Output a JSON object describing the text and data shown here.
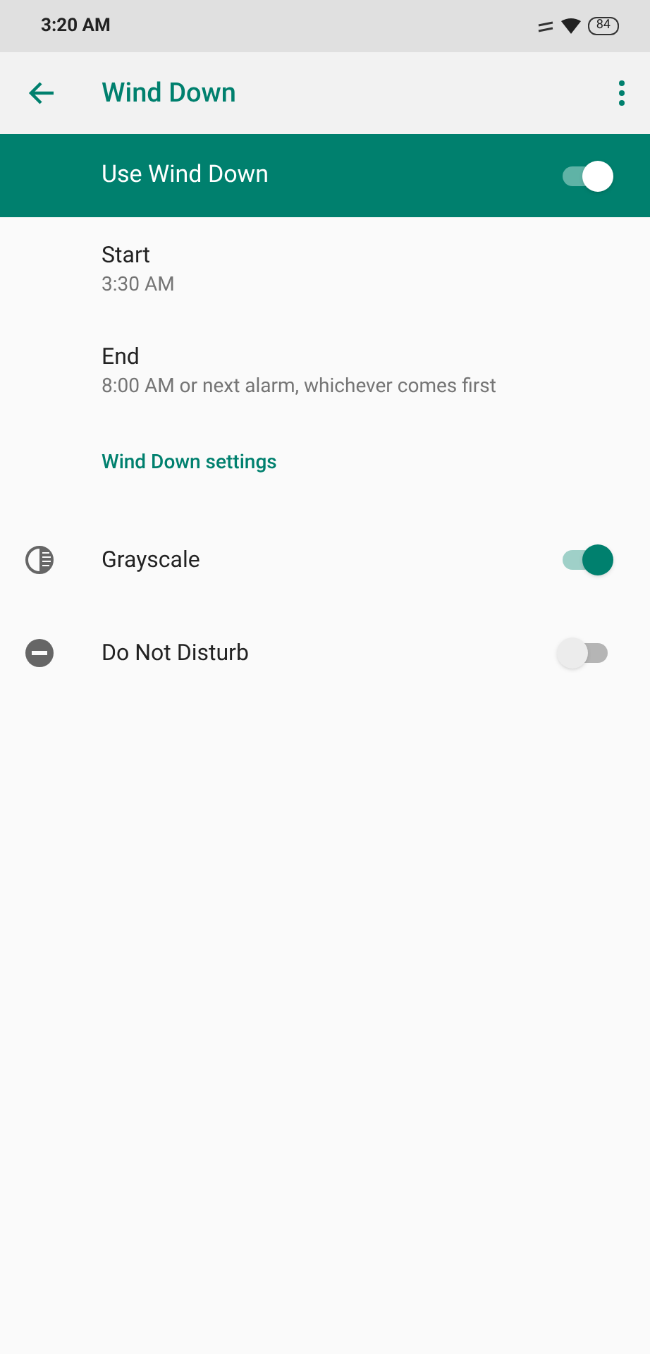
{
  "status_bar": {
    "time": "3:20 AM",
    "battery": "84"
  },
  "app_bar": {
    "title": "Wind Down"
  },
  "master_switch": {
    "label": "Use Wind Down",
    "on": true
  },
  "schedule": [
    {
      "title": "Start",
      "summary": "3:30 AM"
    },
    {
      "title": "End",
      "summary": "8:00 AM or next alarm, whichever comes first"
    }
  ],
  "settings_link": "Wind Down settings",
  "toggles": [
    {
      "kind": "grayscale",
      "label": "Grayscale",
      "on": true
    },
    {
      "kind": "dnd",
      "label": "Do Not Disturb",
      "on": false
    }
  ]
}
